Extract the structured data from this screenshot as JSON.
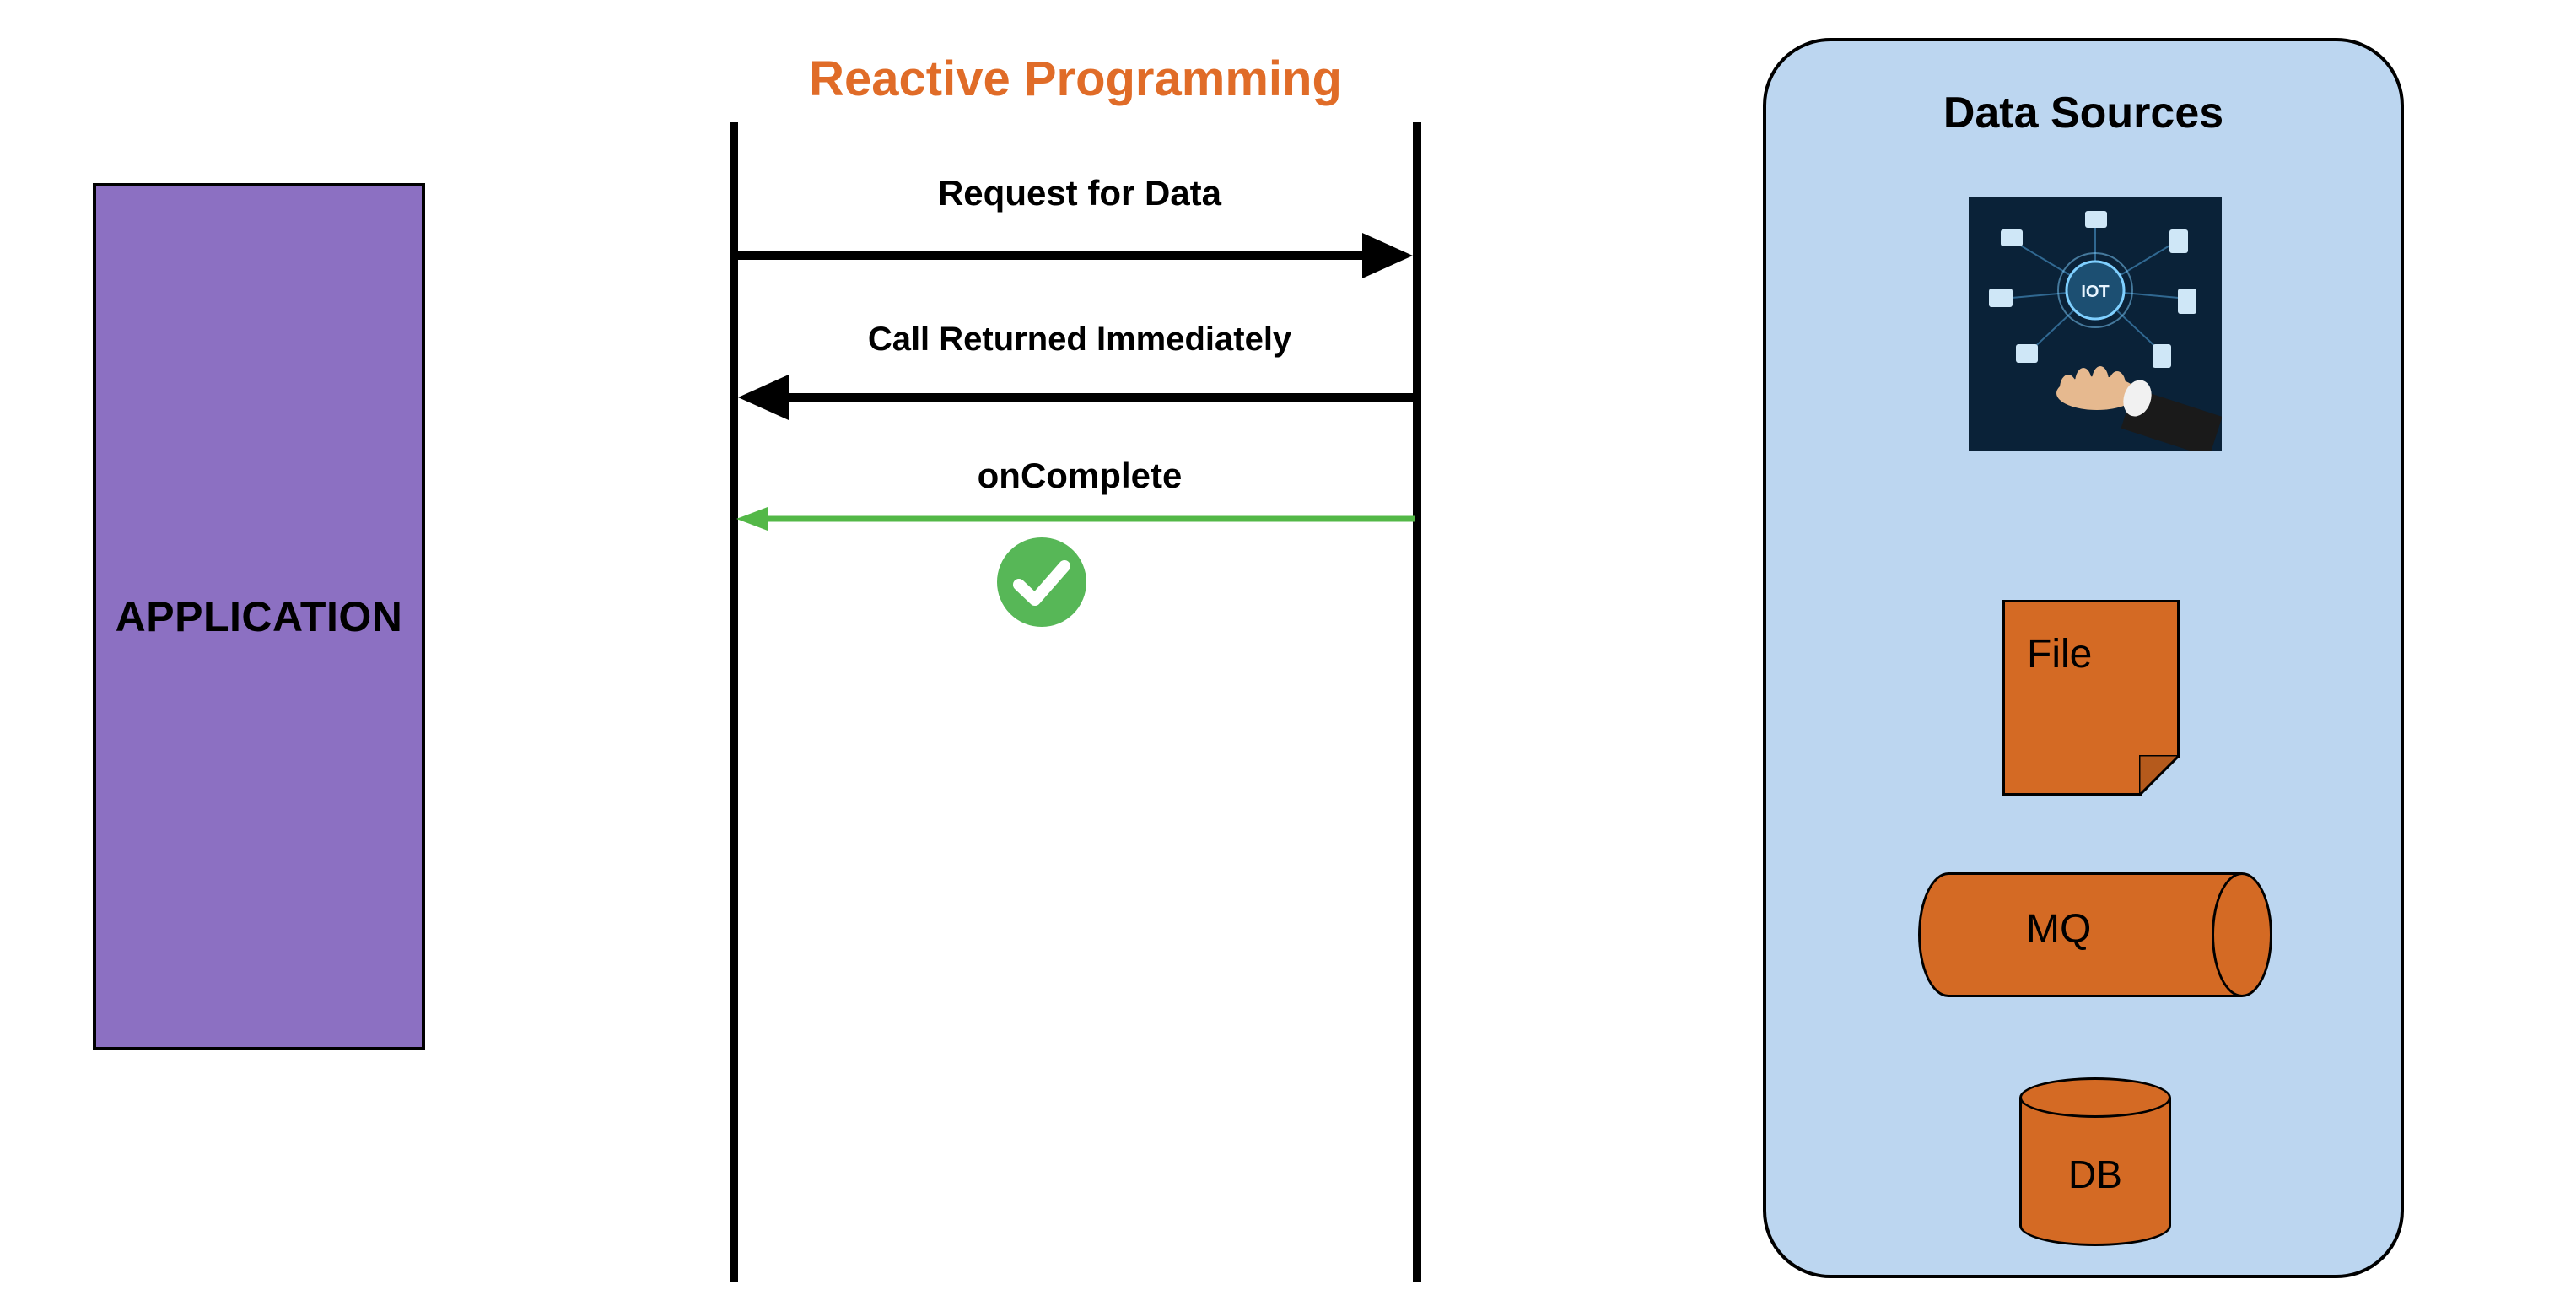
{
  "application": {
    "label": "APPLICATION"
  },
  "diagram": {
    "title": "Reactive Programming",
    "messages": {
      "request": "Request for Data",
      "returned": "Call Returned Immediately",
      "oncomplete": "onComplete"
    }
  },
  "data_sources": {
    "title": "Data Sources",
    "iot_image_alt": "IoT",
    "file_label": "File",
    "mq_label": "MQ",
    "db_label": "DB"
  },
  "colors": {
    "accent_orange": "#e06c28",
    "shape_orange": "#d46a24",
    "panel_blue": "#bcd6f0",
    "app_purple": "#8c70c2",
    "success_green": "#57b757"
  }
}
